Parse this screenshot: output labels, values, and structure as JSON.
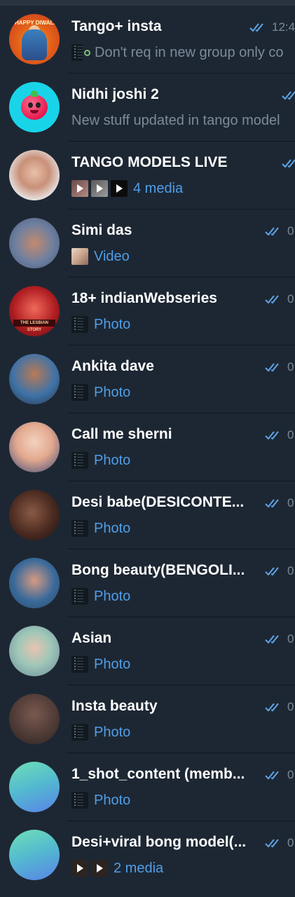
{
  "chats": [
    {
      "name": "Tango+ insta",
      "time": "12:4",
      "preview_text": "Don't req in new group only co",
      "avatar_label": "HAPPY DIWALI"
    },
    {
      "name": "Nidhi joshi 2",
      "time": "",
      "preview_text": "New stuff updated in tango model"
    },
    {
      "name": "TANGO MODELS LIVE",
      "time": "",
      "preview_text": "4 media"
    },
    {
      "name": "Simi das",
      "time": "0",
      "preview_text": "Video"
    },
    {
      "name": "18+ indianWebseries",
      "time": "0",
      "preview_text": "Photo",
      "avatar_label": "THE LESBIAN STORY"
    },
    {
      "name": "Ankita dave",
      "time": "0",
      "preview_text": "Photo"
    },
    {
      "name": "Call me sherni",
      "time": "0",
      "preview_text": "Photo"
    },
    {
      "name": "Desi babe(DESICONTE...",
      "time": "0",
      "preview_text": "Photo"
    },
    {
      "name": "Bong beauty(BENGOLI...",
      "time": "0",
      "preview_text": "Photo"
    },
    {
      "name": "Asian",
      "time": "0",
      "preview_text": "Photo"
    },
    {
      "name": "Insta beauty",
      "time": "0",
      "preview_text": "Photo"
    },
    {
      "name": "1_shot_content (memb...",
      "time": "0",
      "preview_text": "Photo"
    },
    {
      "name": "Desi+viral bong model(...",
      "time": "0",
      "preview_text": "2 media"
    }
  ],
  "colors": {
    "background": "#1d2733",
    "accent": "#4f9ee8",
    "read_checks": "#5ea6ea",
    "title": "#ffffff",
    "muted": "#7d8b99"
  }
}
